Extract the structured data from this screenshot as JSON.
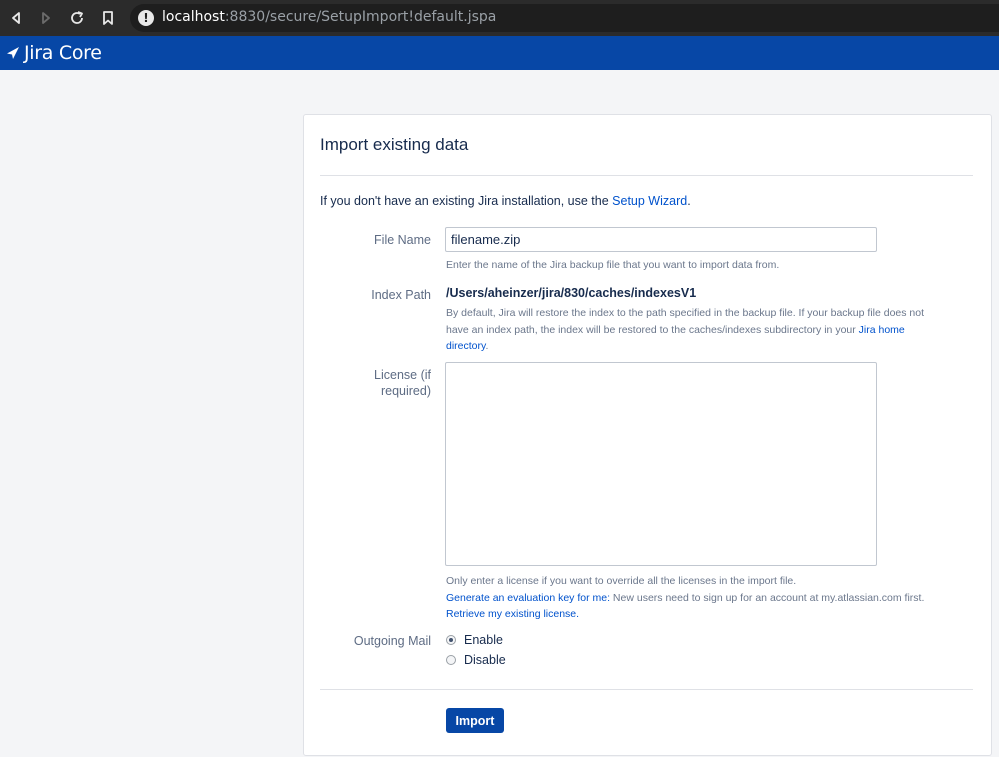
{
  "browser": {
    "url_host": "localhost",
    "url_rest": ":8830/secure/SetupImport!default.jspa",
    "info_glyph": "!"
  },
  "header": {
    "product_name": "Jira Core",
    "brand_color": "#0747a6"
  },
  "panel": {
    "title": "Import existing data",
    "intro_prefix": "If you don't have an existing Jira installation, use the ",
    "intro_link": "Setup Wizard",
    "intro_suffix": "."
  },
  "form": {
    "file_name": {
      "label": "File Name",
      "value": "filename.zip",
      "description": "Enter the name of the Jira backup file that you want to import data from."
    },
    "index_path": {
      "label": "Index Path",
      "value": "/Users/aheinzer/jira/830/caches/indexesV1",
      "description_line1": "By default, Jira will restore the index to the path specified in the backup file. If your backup file does not",
      "description_line2_prefix": "have an index path, the index will be restored to the caches/indexes subdirectory in your ",
      "description_link_part1": "Jira home",
      "description_link_part2": "directory",
      "description_end": "."
    },
    "license": {
      "label_line1": "License (if",
      "label_line2": "required)",
      "value": "",
      "note": "Only enter a license if you want to override all the licenses in the import file.",
      "eval_link": "Generate an evaluation key for me:",
      "eval_text": " New users need to sign up for an account at my.atlassian.com first.",
      "retrieve_link": "Retrieve my existing license."
    },
    "outgoing_mail": {
      "label": "Outgoing Mail",
      "options": [
        {
          "label": "Enable",
          "checked": true
        },
        {
          "label": "Disable",
          "checked": false
        }
      ]
    },
    "submit_label": "Import"
  }
}
